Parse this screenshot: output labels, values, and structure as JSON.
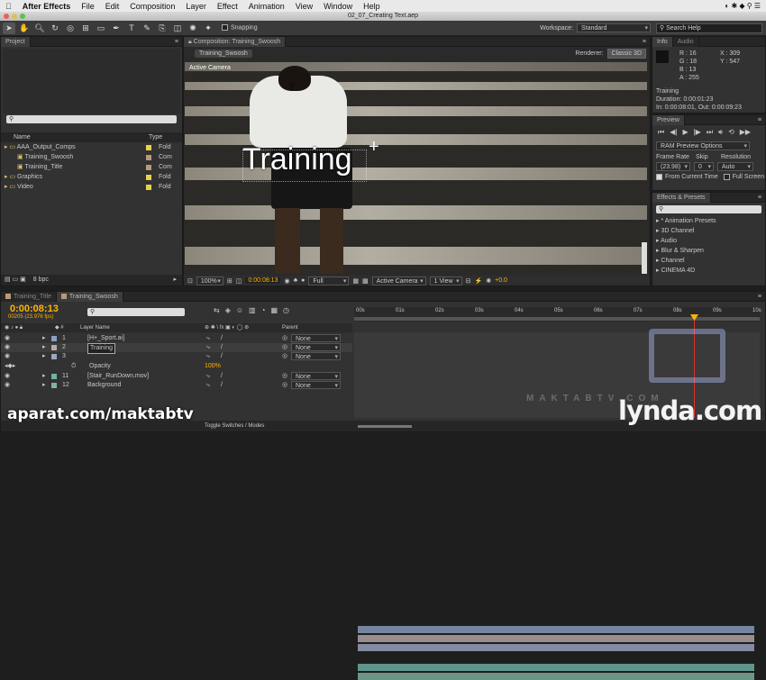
{
  "menubar": {
    "apple_icon": "apple-icon",
    "app_name": "After Effects",
    "items": [
      "File",
      "Edit",
      "Composition",
      "Layer",
      "Effect",
      "Animation",
      "View",
      "Window",
      "Help"
    ]
  },
  "titlebar": {
    "title": "02_07_Creating Text.aep"
  },
  "toolbar": {
    "snapping_label": "Snapping",
    "workspace_label": "Workspace:",
    "workspace_value": "Standard",
    "search_placeholder": "Search Help"
  },
  "project": {
    "tab": "Project",
    "search_placeholder": "",
    "col_name": "Name",
    "col_type": "Type",
    "items": [
      {
        "name": "AAA_Output_Comps",
        "type": "Fold",
        "color": "#e8d24a",
        "indent": 0
      },
      {
        "name": "Training_Swoosh",
        "type": "Com",
        "color": "#b79a7a",
        "indent": 1
      },
      {
        "name": "Training_Title",
        "type": "Com",
        "color": "#b79a7a",
        "indent": 1
      },
      {
        "name": "Graphics",
        "type": "Fold",
        "color": "#e8d24a",
        "indent": 0
      },
      {
        "name": "Video",
        "type": "Fold",
        "color": "#e8d24a",
        "indent": 0
      }
    ],
    "bpc": "8 bpc"
  },
  "composition": {
    "tab": "Composition: Training_Swoosh",
    "subtab": "Training_Swoosh",
    "renderer_label": "Renderer:",
    "renderer_value": "Classic 3D",
    "camera_label": "Active Camera",
    "text_layer": "Training",
    "zoom": "100%",
    "timecode": "0:00:08:13",
    "resolution": "Full",
    "view_camera": "Active Camera",
    "view_count": "1 View",
    "exposure": "+0.0"
  },
  "info": {
    "tab": "Info",
    "tab2": "Audio",
    "r": "R : 16",
    "g": "G : 18",
    "b": "B : 13",
    "a": "A : 255",
    "x": "X : 309",
    "y": "Y : 547",
    "layer_name": "Training",
    "duration": "Duration: 0:00:01:23",
    "in_out": "In: 0:00:08:01, Out: 0:00:09:23"
  },
  "preview": {
    "tab": "Preview",
    "ram_options": "RAM Preview Options",
    "frame_rate_label": "Frame Rate",
    "skip_label": "Skip",
    "resolution_label": "Resolution",
    "frame_rate_value": "(23.98)",
    "skip_value": "0",
    "resolution_value": "Auto",
    "from_current": "From Current Time",
    "full_screen": "Full Screen"
  },
  "effects": {
    "tab": "Effects & Presets",
    "search_placeholder": "",
    "items": [
      "* Animation Presets",
      "3D Channel",
      "Audio",
      "Blur & Sharpen",
      "Channel",
      "CINEMA 4D"
    ]
  },
  "timeline": {
    "tabs": [
      "Training_Title",
      "Training_Swoosh"
    ],
    "timecode": "0:00:08:13",
    "frame_info": "00205 (23.976 fps)",
    "search_placeholder": "",
    "col_layer_name": "Layer Name",
    "col_parent": "Parent",
    "ruler": [
      "00s",
      "01s",
      "02s",
      "03s",
      "04s",
      "05s",
      "06s",
      "07s",
      "08s",
      "09s",
      "10s"
    ],
    "layers": [
      {
        "num": "1",
        "name": "[H+_Sport.ai]",
        "parent": "None",
        "bar": "#8b9fc0",
        "start": 0.0,
        "end": 1.0
      },
      {
        "num": "2",
        "name": "Training",
        "parent": "None",
        "bar": "#b9a9a9",
        "start": 0.0,
        "end": 1.0,
        "selected": true
      },
      {
        "num": "3",
        "name": "",
        "parent": "None",
        "bar": "#9ca6c3",
        "start": 0.0,
        "end": 1.0
      },
      {
        "num": "11",
        "name": "[Stair_RunDown.mov]",
        "parent": "None",
        "bar": "#6fb3a7",
        "start": 0.0,
        "end": 1.0
      },
      {
        "num": "12",
        "name": "Background",
        "parent": "None",
        "bar": "#7fb39f",
        "start": 0.0,
        "end": 1.0
      }
    ],
    "opacity_label": "Opacity",
    "opacity_value": "100%",
    "toggle_label": "Toggle Switches / Modes"
  },
  "watermarks": {
    "aparat": "aparat.com/maktabtv",
    "lynda": "lynda.com",
    "maktab": "MAKTABTV.COM"
  }
}
